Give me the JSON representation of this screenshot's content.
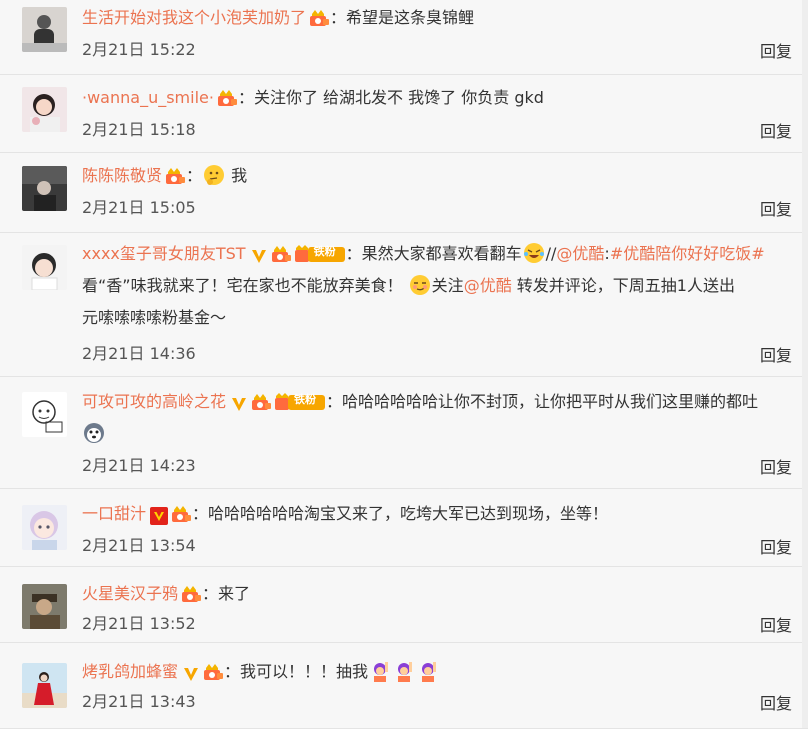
{
  "colors": {
    "username": "#eb7350",
    "link": "#eb7350",
    "text": "#333333",
    "background": "#f7f7f7",
    "divider": "#e4e4e4"
  },
  "reply_label": "回复",
  "comments": [
    {
      "username": "生活开始对我这个小泡芙加奶了",
      "badges": [
        "vip-icon"
      ],
      "colon": "：",
      "lines": [
        [
          {
            "t": "text",
            "v": "希望是这条臭锦鲤"
          }
        ]
      ],
      "timestamp": "2月21日 15:22",
      "avatar": "person-gray"
    },
    {
      "username": "·wanna_u_smile·",
      "badges": [
        "vip-icon"
      ],
      "colon": "：",
      "lines": [
        [
          {
            "t": "text",
            "v": "关注你了 给湖北发不 我馋了  你负责  gkd"
          }
        ]
      ],
      "timestamp": "2月21日 15:18",
      "avatar": "girl"
    },
    {
      "username": "陈陈陈敬贤",
      "badges": [
        "vip-icon"
      ],
      "colon": "：",
      "lines": [
        [
          {
            "t": "emoji",
            "v": "thinking-emoji-icon"
          },
          {
            "t": "text",
            "v": " 我"
          }
        ]
      ],
      "timestamp": "2月21日 15:05",
      "avatar": "dark-person"
    },
    {
      "username": "xxxx玺子哥女朋友TST",
      "badges": [
        "verified-icon",
        "vip-icon",
        "fan-badge-icon"
      ],
      "fan_badge": "铁粉",
      "colon": "：",
      "lines": [
        [
          {
            "t": "text",
            "v": "果然大家都喜欢看翻车"
          },
          {
            "t": "emoji",
            "v": "laughing-emoji-icon"
          },
          {
            "t": "text",
            "v": "//"
          },
          {
            "t": "link",
            "v": "@优酷"
          },
          {
            "t": "text",
            "v": ":"
          },
          {
            "t": "link",
            "v": "#优酷陪你好好吃饭#"
          }
        ],
        [
          {
            "t": "text",
            "v": "看“香”味我就来了！宅在家也不能放弃美食！ "
          },
          {
            "t": "emoji",
            "v": "smirk-emoji-icon"
          },
          {
            "t": "text",
            "v": "关注"
          },
          {
            "t": "link",
            "v": "@优酷"
          },
          {
            "t": "text",
            "v": " 转发并评论，下周五抽1人送出"
          }
        ],
        [
          {
            "t": "text",
            "v": "元嗦嗦嗦嗦粉基金～"
          }
        ]
      ],
      "timestamp": "2月21日 14:36",
      "avatar": "boy"
    },
    {
      "username": "可攻可攻的高岭之花",
      "badges": [
        "verified-icon",
        "vip-icon",
        "fan-badge-icon"
      ],
      "fan_badge": "铁粉",
      "colon": "：",
      "lines": [
        [
          {
            "t": "text",
            "v": "哈哈哈哈哈哈让你不封顶，让你把平时从我们这里赚的都吐"
          }
        ],
        [
          {
            "t": "emoji",
            "v": "husky-emoji-icon"
          }
        ]
      ],
      "timestamp": "2月21日 14:23",
      "avatar": "cartoon-sketch"
    },
    {
      "username": "一口甜汁",
      "badges": [
        "red-verified-icon",
        "vip-icon"
      ],
      "colon": "：",
      "lines": [
        [
          {
            "t": "text",
            "v": "哈哈哈哈哈哈淘宝又来了，吃垮大军已达到现场，坐等！"
          }
        ]
      ],
      "timestamp": "2月21日 13:54",
      "avatar": "anime-girl"
    },
    {
      "username": "火星美汉子鸦",
      "badges": [
        "vip-icon"
      ],
      "colon": "：",
      "lines": [
        [
          {
            "t": "text",
            "v": "来了"
          }
        ]
      ],
      "timestamp": "2月21日 13:52",
      "avatar": "hat-man"
    },
    {
      "username": "烤乳鸽加蜂蜜",
      "badges": [
        "verified-icon",
        "vip-icon"
      ],
      "colon": "：",
      "lines": [
        [
          {
            "t": "text",
            "v": "我可以！！！抽我"
          },
          {
            "t": "emoji",
            "v": "raise-hand-emoji-icon"
          },
          {
            "t": "emoji",
            "v": "raise-hand-emoji-icon"
          },
          {
            "t": "emoji",
            "v": "raise-hand-emoji-icon"
          }
        ]
      ],
      "timestamp": "2月21日 13:43",
      "avatar": "red-dress"
    }
  ]
}
